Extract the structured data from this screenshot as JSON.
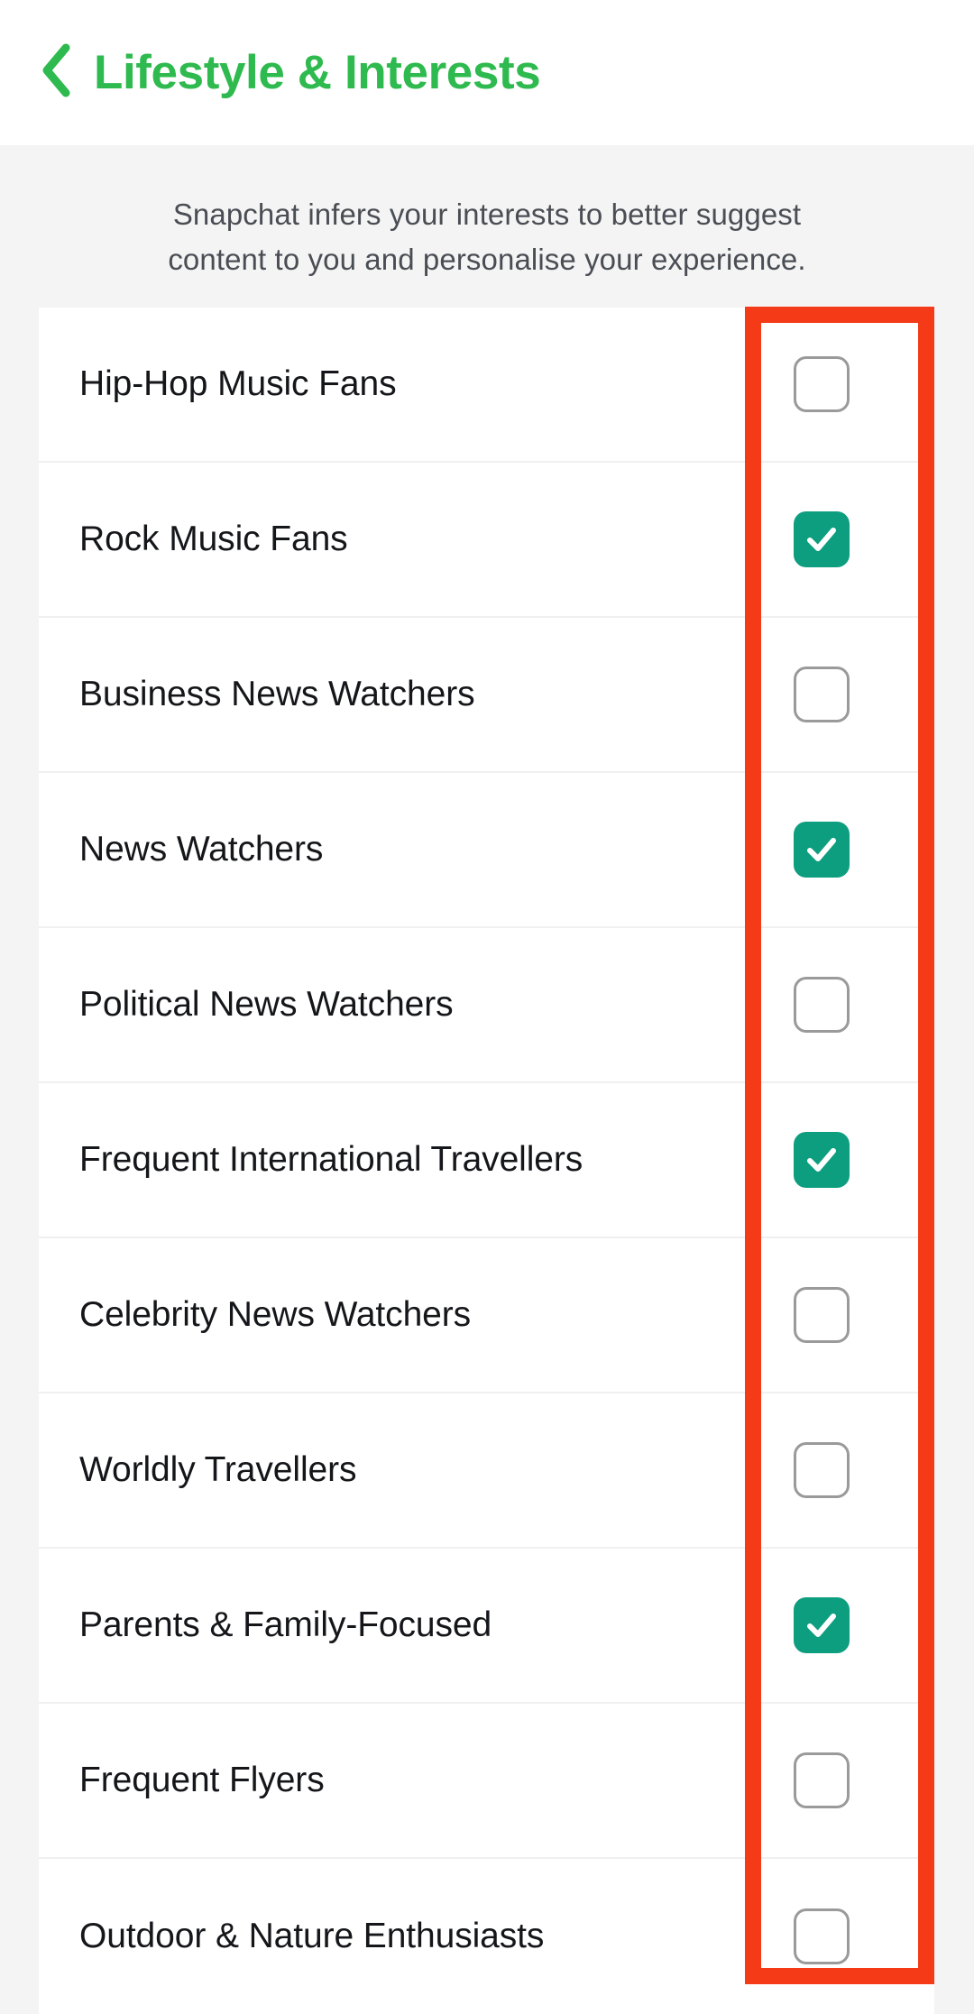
{
  "navbar": {
    "back_icon": "chevron-left-icon",
    "title": "Lifestyle & Interests",
    "accent_color": "#2eba4e"
  },
  "description": {
    "line1": "Snapchat infers your interests to better suggest",
    "line2": "content to you and personalise your experience."
  },
  "annotation": {
    "color": "#f43a17",
    "target": "checkbox-column"
  },
  "theme": {
    "checked_color": "#0d9e7f",
    "unchecked_border": "#9a9a9a",
    "page_background": "#f4f4f4",
    "card_background": "#ffffff",
    "text_color": "#15161a"
  },
  "list": {
    "items": [
      {
        "label": "Hip-Hop Music Fans",
        "checked": false
      },
      {
        "label": "Rock Music Fans",
        "checked": true
      },
      {
        "label": "Business News Watchers",
        "checked": false
      },
      {
        "label": "News Watchers",
        "checked": true
      },
      {
        "label": "Political News Watchers",
        "checked": false
      },
      {
        "label": "Frequent International Travellers",
        "checked": true
      },
      {
        "label": "Celebrity News Watchers",
        "checked": false
      },
      {
        "label": "Worldly Travellers",
        "checked": false
      },
      {
        "label": "Parents & Family-Focused",
        "checked": true
      },
      {
        "label": "Frequent Flyers",
        "checked": false
      },
      {
        "label": "Outdoor & Nature Enthusiasts",
        "checked": false
      }
    ]
  }
}
